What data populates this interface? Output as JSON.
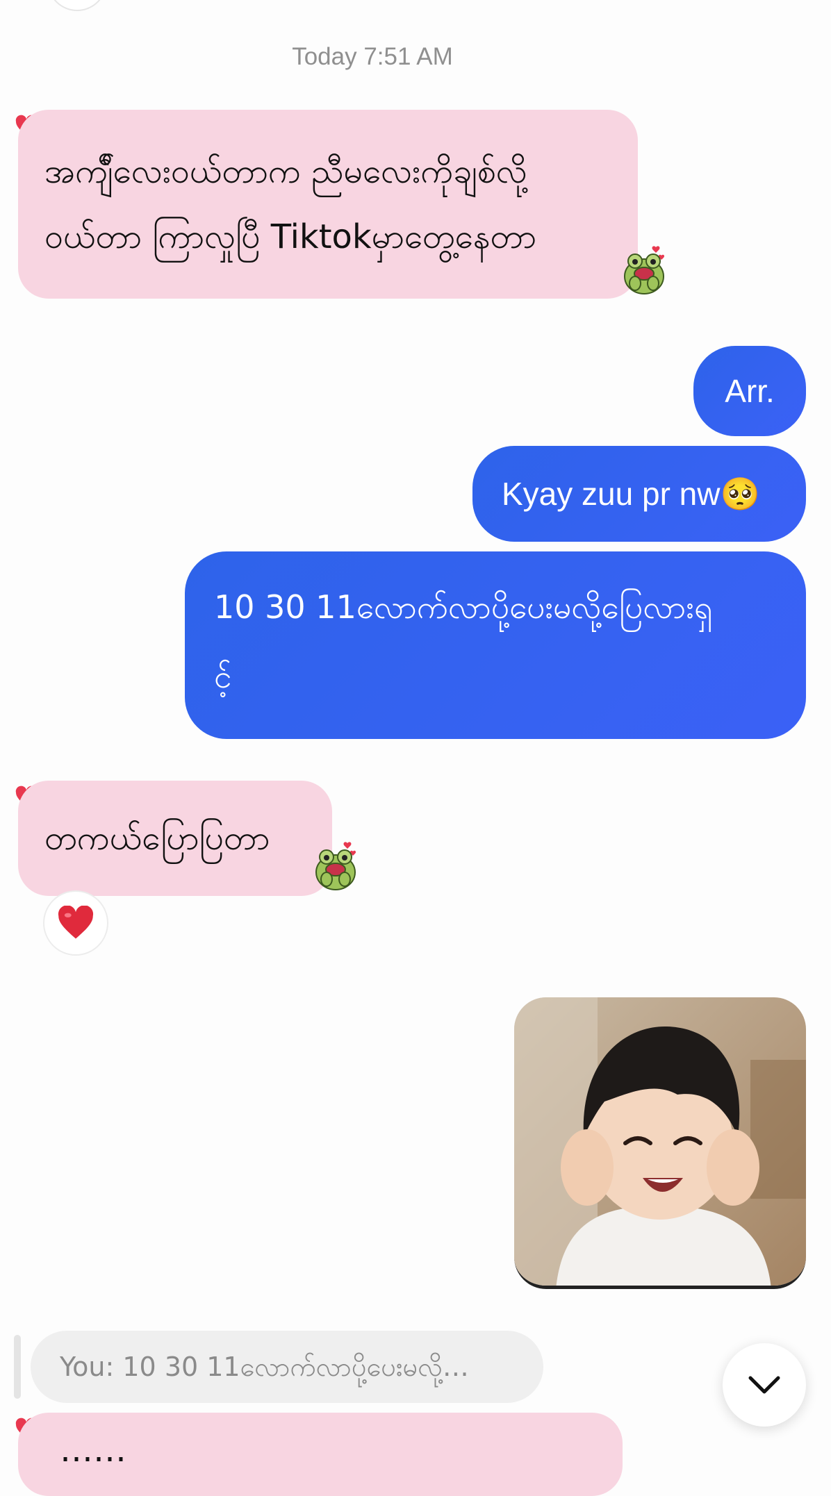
{
  "thread": {
    "timestamp": "Today 7:51 AM",
    "messages": [
      {
        "direction": "incoming",
        "lines": [
          "အကျ်ီလေးဝယ်တာက ညီမလေးကိုချစ်လို့",
          "ဝယ်တာ ကြာလှုပြီ Tiktokမှာတွေ့နေတာ"
        ],
        "reaction_sticker": "frog-sticker-icon"
      },
      {
        "direction": "outgoing",
        "text": "Arr."
      },
      {
        "direction": "outgoing",
        "text": "Kyay zuu pr nw🥺"
      },
      {
        "direction": "outgoing",
        "lines": [
          "10 30 11လောက်လာပို့ပေးမလို့ပြေလားရှ",
          "င့်"
        ]
      },
      {
        "direction": "incoming",
        "text": "တကယ်ပြောပြတာ",
        "reaction": "❤️",
        "reaction_sticker": "frog-sticker-icon"
      },
      {
        "direction": "outgoing",
        "type": "image",
        "image_desc": "photo-of-smiling-child"
      }
    ],
    "reply_preview": "You: 10 30 11လောက်လာပို့ပေးမလို့…",
    "partial_message": "……"
  },
  "colors": {
    "incoming_bubble": "#f8d5e1",
    "outgoing_bubble": "#3461f0",
    "timestamp_text": "#8f8f8f",
    "heart": "#e8384f"
  },
  "icons": {
    "scroll_down": "chevron-down-icon",
    "liked_marker": "heart-icon"
  }
}
